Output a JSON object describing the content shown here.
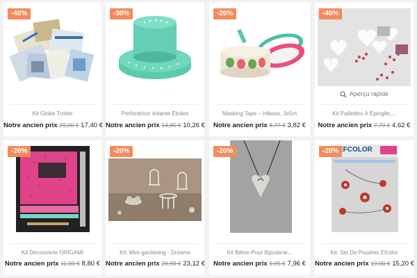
{
  "products": [
    {
      "badge": "-40%",
      "name": "Kit Globe Trotter",
      "price_label": "Notre ancien prix",
      "old_price": "29,00 €",
      "new_price": "17,40 €",
      "image": "travel-kit-image"
    },
    {
      "badge": "-30%",
      "name": "Perforatrice Volante Étoiles",
      "price_label": "Notre ancien prix",
      "old_price": "14,65 €",
      "new_price": "10,26 €",
      "image": "punch-image"
    },
    {
      "badge": "-20%",
      "name": "Masking Tape – Hiboux, 3x5m",
      "price_label": "Notre ancien prix",
      "old_price": "4,77 €",
      "new_price": "3,82 €",
      "image": "tape-image"
    },
    {
      "badge": "-40%",
      "name": "Kit Paillettes À Épingler,...",
      "price_label": "Notre ancien prix",
      "old_price": "7,70 €",
      "new_price": "4,62 €",
      "image": "glitter-image",
      "quick_view": "Aperçu rapide"
    },
    {
      "badge": "-20%",
      "name": "Kit Découverte ORIGAMI",
      "price_label": "Notre ancien prix",
      "old_price": "11,00 €",
      "new_price": "8,80 €",
      "image": "origami-image"
    },
    {
      "badge": "-20%",
      "name": "Kit: Mini-gardening - Dreams",
      "price_label": "Notre ancien prix",
      "old_price": "28,90 €",
      "new_price": "23,12 €",
      "image": "garden-image"
    },
    {
      "badge": "-20%",
      "name": "Kit Béton Pour Bijouterie...",
      "price_label": "Notre ancien prix",
      "old_price": "9,95 €",
      "new_price": "7,96 €",
      "image": "concrete-image"
    },
    {
      "badge": "-20%",
      "name": "Kit: Set De Poudres Efcolor",
      "price_label": "Notre ancien prix",
      "old_price": "19,00 €",
      "new_price": "15,20 €",
      "image": "efcolor-image",
      "efcolor": "EFCOLOR"
    }
  ]
}
